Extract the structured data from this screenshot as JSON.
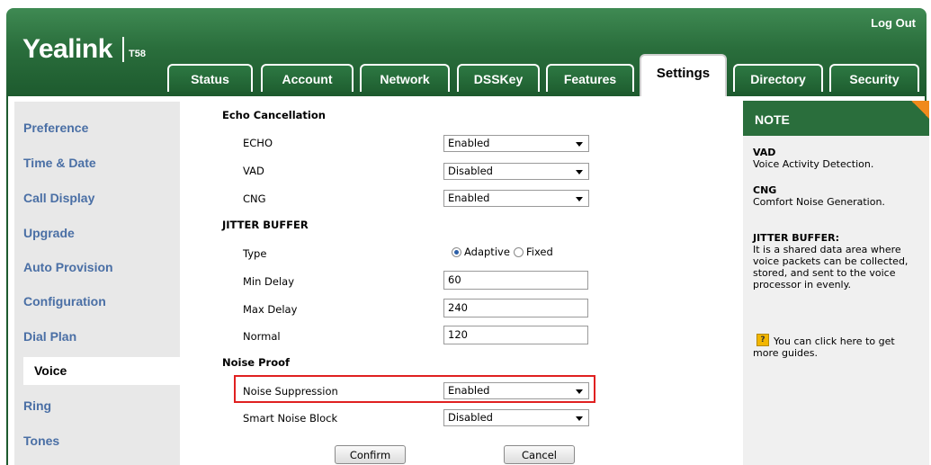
{
  "header": {
    "logo": "Yealink",
    "model": "T58",
    "logout": "Log Out"
  },
  "tabs": [
    {
      "label": "Status",
      "active": false
    },
    {
      "label": "Account",
      "active": false
    },
    {
      "label": "Network",
      "active": false
    },
    {
      "label": "DSSKey",
      "active": false
    },
    {
      "label": "Features",
      "active": false
    },
    {
      "label": "Settings",
      "active": true
    },
    {
      "label": "Directory",
      "active": false
    },
    {
      "label": "Security",
      "active": false
    }
  ],
  "sidebar": {
    "items": [
      {
        "label": "Preference"
      },
      {
        "label": "Time & Date"
      },
      {
        "label": "Call Display"
      },
      {
        "label": "Upgrade"
      },
      {
        "label": "Auto Provision"
      },
      {
        "label": "Configuration"
      },
      {
        "label": "Dial Plan"
      },
      {
        "label": "Voice",
        "active": true
      },
      {
        "label": "Ring"
      },
      {
        "label": "Tones"
      }
    ]
  },
  "form": {
    "echo_section": "Echo Cancellation",
    "echo": {
      "label": "ECHO",
      "value": "Enabled"
    },
    "vad": {
      "label": "VAD",
      "value": "Disabled"
    },
    "cng": {
      "label": "CNG",
      "value": "Enabled"
    },
    "jitter_section": "JITTER BUFFER",
    "type": {
      "label": "Type",
      "options": [
        "Adaptive",
        "Fixed"
      ],
      "selected": "Adaptive"
    },
    "min_delay": {
      "label": "Min Delay",
      "value": "60"
    },
    "max_delay": {
      "label": "Max Delay",
      "value": "240"
    },
    "normal": {
      "label": "Normal",
      "value": "120"
    },
    "noise_section": "Noise Proof",
    "noise_suppression": {
      "label": "Noise Suppression",
      "value": "Enabled"
    },
    "smart_noise_block": {
      "label": "Smart Noise Block",
      "value": "Disabled"
    },
    "confirm": "Confirm",
    "cancel": "Cancel"
  },
  "note": {
    "title": "NOTE",
    "vad_title": "VAD",
    "vad_text": "Voice Activity Detection.",
    "cng_title": "CNG",
    "cng_text": "Comfort Noise Generation.",
    "jitter_title": "JITTER BUFFER:",
    "jitter_text": [
      "It is a shared data area where",
      "voice packets can be collected,",
      "stored, and sent to the voice",
      "processor in evenly."
    ],
    "guide_text": [
      "You can click here to get",
      "more guides."
    ],
    "guide_icon": "help-book-icon"
  },
  "colors": {
    "header_green": "#2a6e3c",
    "sidebar_link": "#4a6fa5",
    "highlight_red": "#e02020",
    "note_corner": "#f08a1c"
  }
}
